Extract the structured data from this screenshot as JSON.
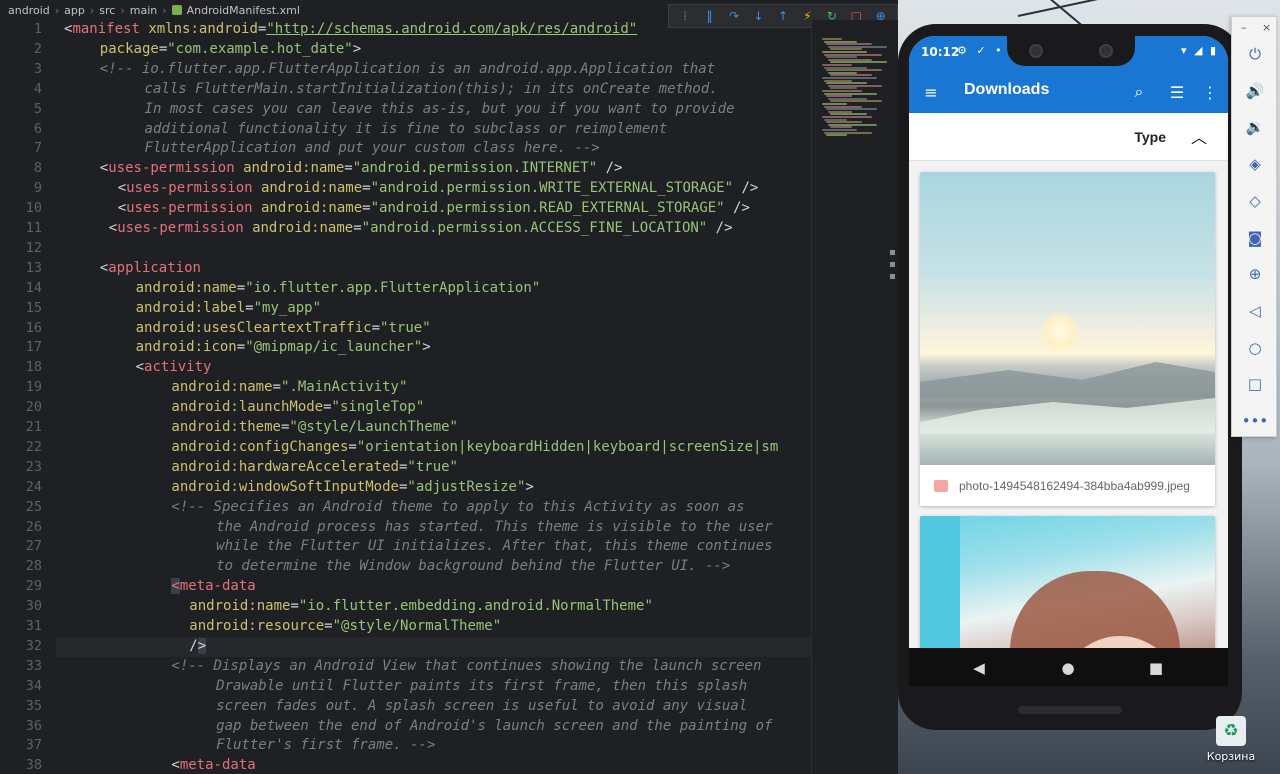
{
  "breadcrumb": [
    {
      "label": "android"
    },
    {
      "label": "app"
    },
    {
      "label": "src"
    },
    {
      "label": "main"
    },
    {
      "label": "AndroidManifest.xml"
    }
  ],
  "debug_toolbar": {
    "icons": [
      "grip-icon",
      "pause-icon",
      "step-over-icon",
      "step-into-icon",
      "step-out-icon",
      "hot-reload-icon",
      "hot-restart-icon",
      "stop-icon",
      "inspect-icon"
    ],
    "glyphs": [
      "⁞",
      "‖",
      "↷",
      "↓",
      "↑",
      "⚡",
      "↻",
      "□",
      "⊕"
    ]
  },
  "editor": {
    "file_name": "AndroidManifest.xml",
    "current_line": 32,
    "lines": [
      {
        "n": "1",
        "indent": 0,
        "parts": [
          [
            "p",
            "<"
          ],
          [
            "t",
            "manifest"
          ],
          [
            "p",
            " "
          ],
          [
            "a",
            "xmlns:android"
          ],
          [
            "p",
            "="
          ],
          [
            "u",
            "\"http://schemas.android.com/apk/res/android\""
          ]
        ]
      },
      {
        "n": "2",
        "indent": 4,
        "parts": [
          [
            "a",
            "package"
          ],
          [
            "p",
            "="
          ],
          [
            "v",
            "\"com.example.hot_date\""
          ],
          [
            "p",
            ">"
          ]
        ]
      },
      {
        "n": "3",
        "indent": 4,
        "parts": [
          [
            "c",
            "<!-- io.flutter.app.FlutterApplication is an android.app.Application that"
          ]
        ]
      },
      {
        "n": "4",
        "indent": 9,
        "parts": [
          [
            "c",
            "calls FlutterMain.startInitialization(this); in its onCreate method."
          ]
        ]
      },
      {
        "n": "5",
        "indent": 9,
        "parts": [
          [
            "c",
            "In most cases you can leave this as-is, but you if you want to provide"
          ]
        ]
      },
      {
        "n": "6",
        "indent": 9,
        "parts": [
          [
            "c",
            "additional functionality it is fine to subclass or reimplement"
          ]
        ]
      },
      {
        "n": "7",
        "indent": 9,
        "parts": [
          [
            "c",
            "FlutterApplication and put your custom class here. -->"
          ]
        ]
      },
      {
        "n": "8",
        "indent": 4,
        "parts": [
          [
            "p",
            "<"
          ],
          [
            "t",
            "uses-permission"
          ],
          [
            "p",
            " "
          ],
          [
            "a",
            "android:name"
          ],
          [
            "p",
            "="
          ],
          [
            "v",
            "\"android.permission.INTERNET\""
          ],
          [
            "p",
            " />"
          ]
        ]
      },
      {
        "n": "9",
        "indent": 6,
        "parts": [
          [
            "p",
            "<"
          ],
          [
            "t",
            "uses-permission"
          ],
          [
            "p",
            " "
          ],
          [
            "a",
            "android:name"
          ],
          [
            "p",
            "="
          ],
          [
            "v",
            "\"android.permission.WRITE_EXTERNAL_STORAGE\""
          ],
          [
            "p",
            " />"
          ]
        ]
      },
      {
        "n": "10",
        "indent": 6,
        "parts": [
          [
            "p",
            "<"
          ],
          [
            "t",
            "uses-permission"
          ],
          [
            "p",
            " "
          ],
          [
            "a",
            "android:name"
          ],
          [
            "p",
            "="
          ],
          [
            "v",
            "\"android.permission.READ_EXTERNAL_STORAGE\""
          ],
          [
            "p",
            " />"
          ]
        ]
      },
      {
        "n": "11",
        "indent": 5,
        "parts": [
          [
            "p",
            "<"
          ],
          [
            "t",
            "uses-permission"
          ],
          [
            "p",
            " "
          ],
          [
            "a",
            "android:name"
          ],
          [
            "p",
            "="
          ],
          [
            "v",
            "\"android.permission.ACCESS_FINE_LOCATION\""
          ],
          [
            "p",
            " />"
          ]
        ]
      },
      {
        "n": "12",
        "indent": 0,
        "parts": []
      },
      {
        "n": "13",
        "indent": 4,
        "parts": [
          [
            "p",
            "<"
          ],
          [
            "t",
            "application"
          ]
        ]
      },
      {
        "n": "14",
        "indent": 8,
        "parts": [
          [
            "a",
            "android:name"
          ],
          [
            "p",
            "="
          ],
          [
            "v",
            "\"io.flutter.app.FlutterApplication\""
          ]
        ]
      },
      {
        "n": "15",
        "indent": 8,
        "parts": [
          [
            "a",
            "android:label"
          ],
          [
            "p",
            "="
          ],
          [
            "v",
            "\"my_app\""
          ]
        ]
      },
      {
        "n": "16",
        "indent": 8,
        "parts": [
          [
            "a",
            "android:usesCleartextTraffic"
          ],
          [
            "p",
            "="
          ],
          [
            "v",
            "\"true\""
          ]
        ]
      },
      {
        "n": "17",
        "indent": 8,
        "parts": [
          [
            "a",
            "android:icon"
          ],
          [
            "p",
            "="
          ],
          [
            "v",
            "\"@mipmap/ic_launcher\""
          ],
          [
            "p",
            ">"
          ]
        ]
      },
      {
        "n": "18",
        "indent": 8,
        "parts": [
          [
            "p",
            "<"
          ],
          [
            "t",
            "activity"
          ]
        ]
      },
      {
        "n": "19",
        "indent": 12,
        "parts": [
          [
            "a",
            "android:name"
          ],
          [
            "p",
            "="
          ],
          [
            "v",
            "\".MainActivity\""
          ]
        ]
      },
      {
        "n": "20",
        "indent": 12,
        "parts": [
          [
            "a",
            "android:launchMode"
          ],
          [
            "p",
            "="
          ],
          [
            "v",
            "\"singleTop\""
          ]
        ]
      },
      {
        "n": "21",
        "indent": 12,
        "parts": [
          [
            "a",
            "android:theme"
          ],
          [
            "p",
            "="
          ],
          [
            "v",
            "\"@style/LaunchTheme\""
          ]
        ]
      },
      {
        "n": "22",
        "indent": 12,
        "parts": [
          [
            "a",
            "android:configChanges"
          ],
          [
            "p",
            "="
          ],
          [
            "v",
            "\"orientation|keyboardHidden|keyboard|screenSize|sm"
          ]
        ]
      },
      {
        "n": "23",
        "indent": 12,
        "parts": [
          [
            "a",
            "android:hardwareAccelerated"
          ],
          [
            "p",
            "="
          ],
          [
            "v",
            "\"true\""
          ]
        ]
      },
      {
        "n": "24",
        "indent": 12,
        "parts": [
          [
            "a",
            "android:windowSoftInputMode"
          ],
          [
            "p",
            "="
          ],
          [
            "v",
            "\"adjustResize\""
          ],
          [
            "p",
            ">"
          ]
        ]
      },
      {
        "n": "25",
        "indent": 12,
        "parts": [
          [
            "c",
            "<!-- Specifies an Android theme to apply to this Activity as soon as"
          ]
        ]
      },
      {
        "n": "26",
        "indent": 17,
        "parts": [
          [
            "c",
            "the Android process has started. This theme is visible to the user"
          ]
        ]
      },
      {
        "n": "27",
        "indent": 17,
        "parts": [
          [
            "c",
            "while the Flutter UI initializes. After that, this theme continues"
          ]
        ]
      },
      {
        "n": "28",
        "indent": 17,
        "parts": [
          [
            "c",
            "to determine the Window background behind the Flutter UI. -->"
          ]
        ]
      },
      {
        "n": "29",
        "indent": 12,
        "parts": [
          [
            "m",
            "<"
          ],
          [
            "t",
            "meta-data"
          ]
        ]
      },
      {
        "n": "30",
        "indent": 14,
        "parts": [
          [
            "a",
            "android:name"
          ],
          [
            "p",
            "="
          ],
          [
            "v",
            "\"io.flutter.embedding.android.NormalTheme\""
          ]
        ]
      },
      {
        "n": "31",
        "indent": 14,
        "parts": [
          [
            "a",
            "android:resource"
          ],
          [
            "p",
            "="
          ],
          [
            "v",
            "\"@style/NormalTheme\""
          ]
        ]
      },
      {
        "n": "32",
        "indent": 14,
        "parts": [
          [
            "p",
            "/"
          ],
          [
            "m",
            ">"
          ]
        ]
      },
      {
        "n": "33",
        "indent": 12,
        "parts": [
          [
            "c",
            "<!-- Displays an Android View that continues showing the launch screen"
          ]
        ]
      },
      {
        "n": "34",
        "indent": 17,
        "parts": [
          [
            "c",
            "Drawable until Flutter paints its first frame, then this splash"
          ]
        ]
      },
      {
        "n": "35",
        "indent": 17,
        "parts": [
          [
            "c",
            "screen fades out. A splash screen is useful to avoid any visual"
          ]
        ]
      },
      {
        "n": "36",
        "indent": 17,
        "parts": [
          [
            "c",
            "gap between the end of Android's launch screen and the painting of"
          ]
        ]
      },
      {
        "n": "37",
        "indent": 17,
        "parts": [
          [
            "c",
            "Flutter's first frame. -->"
          ]
        ]
      },
      {
        "n": "38",
        "indent": 12,
        "parts": [
          [
            "p",
            "<"
          ],
          [
            "t",
            "meta-data"
          ]
        ]
      }
    ]
  },
  "phone": {
    "status": {
      "time": "10:12",
      "left_icons": "⚙ ✓ •",
      "right_icons": "▾ ◢ ▮"
    },
    "app_bar": {
      "title": "Downloads",
      "menu_glyph": "≡",
      "search_glyph": "⌕",
      "list_glyph": "☰",
      "more_glyph": "⋮"
    },
    "sort": {
      "label": "Type",
      "toggle_glyph": "︿"
    },
    "files": [
      {
        "name": "photo-1494548162494-384bba4ab999.jpeg"
      }
    ],
    "nav": {
      "back": "◀",
      "home": "●",
      "recents": "■"
    }
  },
  "emulator_panel": {
    "minimize": "–",
    "close": "×",
    "buttons": [
      {
        "name": "power-icon",
        "glyph": "⏻"
      },
      {
        "name": "volume-up-icon",
        "glyph": "🔊"
      },
      {
        "name": "volume-down-icon",
        "glyph": "🔉"
      },
      {
        "name": "rotate-left-icon",
        "glyph": "◈"
      },
      {
        "name": "rotate-right-icon",
        "glyph": "◇"
      },
      {
        "name": "camera-icon",
        "glyph": "◙"
      },
      {
        "name": "zoom-icon",
        "glyph": "⊕"
      },
      {
        "name": "back-icon",
        "glyph": "◁"
      },
      {
        "name": "home-icon",
        "glyph": "○"
      },
      {
        "name": "overview-icon",
        "glyph": "□"
      },
      {
        "name": "more-icon",
        "glyph": "•••"
      }
    ]
  },
  "desktop": {
    "trash_label": "Корзина",
    "trash_glyph": "♻"
  },
  "colors": {
    "accent": "#1976d2",
    "tag": "#e5707d",
    "attr": "#cbc26c",
    "value": "#98c379",
    "comment": "#7a7f87"
  }
}
